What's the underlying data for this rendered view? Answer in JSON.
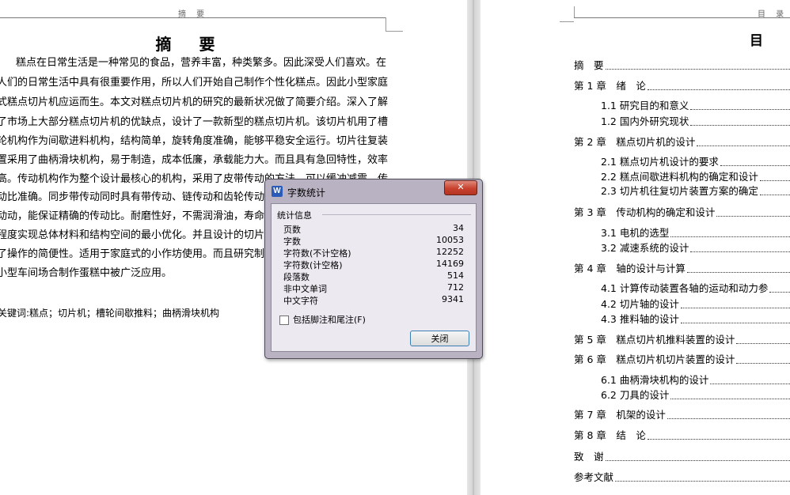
{
  "left_page": {
    "header": "摘 要",
    "title": "摘 要",
    "lines": [
      "糕点在日常生活是一种常见的食品，营养丰富，种类繁多。因此深受人们喜欢。在",
      "人们的日常生活中具有很重要作用，所以人们开始自己制作个性化糕点。因此小型家庭",
      "式糕点切片机应运而生。本文对糕点切片机的研究的最新状况做了简要介绍。深入了解",
      "了市场上大部分糕点切片机的优缺点，设计了一款新型的糕点切片机。该切片机用了槽",
      "轮机构作为间歇进料机构，结构简单，旋转角度准确，能够平稳安全运行。切片往复装",
      "置采用了曲柄滑块机构，易于制造，成本低廉，承载能力大。而且具有急回特性，效率",
      "高。传动机构作为整个设计最核心的机构，采用了皮带传动的方法，可以缓冲减震，传",
      "动比准确。同步带传动同时具有带传动、链传动和齿轮传动",
      "动动，能保证精确的传动比。耐磨性好，不需润滑油，寿命",
      "程度实现总体材料和结构空间的最小优化。并且设计的切片",
      "了操作的简便性。适用于家庭式的小作坊使用。而且研究制",
      "小型车间场合制作蛋糕中被广泛应用。"
    ],
    "keywords": "关键词:糕点；切片机；槽轮间歇推料；曲柄滑块机构"
  },
  "right_page": {
    "header": "目 录",
    "title": "目 录",
    "toc": [
      {
        "text": "摘　要"
      },
      {
        "text": "第 1 章　绪　论"
      },
      {
        "text": "1.1 研究目的和意义"
      },
      {
        "text": "1.2 国内外研究现状"
      },
      {
        "text": "第 2 章　糕点切片机的设计"
      },
      {
        "text": "2.1 糕点切片机设计的要求"
      },
      {
        "text": "2.2 糕点间歇进料机构的确定和设计"
      },
      {
        "text": "2.3 切片机往复切片装置方案的确定"
      },
      {
        "text": "第 3 章　传动机构的确定和设计"
      },
      {
        "text": "3.1 电机的选型"
      },
      {
        "text": "3.2 减速系统的设计"
      },
      {
        "text": "第 4 章　轴的设计与计算"
      },
      {
        "text": "4.1 计算传动装置各轴的运动和动力参"
      },
      {
        "text": "4.2 切片轴的设计"
      },
      {
        "text": "4.3 推料轴的设计"
      },
      {
        "text": "第 5 章　糕点切片机推料装置的设计"
      },
      {
        "text": "第 6 章　糕点切片机切片装置的设计"
      },
      {
        "text": "6.1 曲柄滑块机构的设计"
      },
      {
        "text": "6.2 刀具的设计"
      },
      {
        "text": "第 7 章　机架的设计"
      },
      {
        "text": "第 8 章　结　论"
      },
      {
        "text": "致　谢"
      },
      {
        "text": "参考文献"
      }
    ]
  },
  "dialog": {
    "title": "字数统计",
    "app_icon": "W",
    "close_glyph": "✕",
    "group_label": "统计信息",
    "stats": [
      {
        "label": "页数",
        "value": "34"
      },
      {
        "label": "字数",
        "value": "10053"
      },
      {
        "label": "字符数(不计空格)",
        "value": "12252"
      },
      {
        "label": "字符数(计空格)",
        "value": "14169"
      },
      {
        "label": "段落数",
        "value": "514"
      },
      {
        "label": "非中文单词",
        "value": "712"
      },
      {
        "label": "中文字符",
        "value": "9341"
      }
    ],
    "checkbox_label": "包括脚注和尾注(F)",
    "checkbox_checked": false,
    "close_button": "关闭"
  }
}
